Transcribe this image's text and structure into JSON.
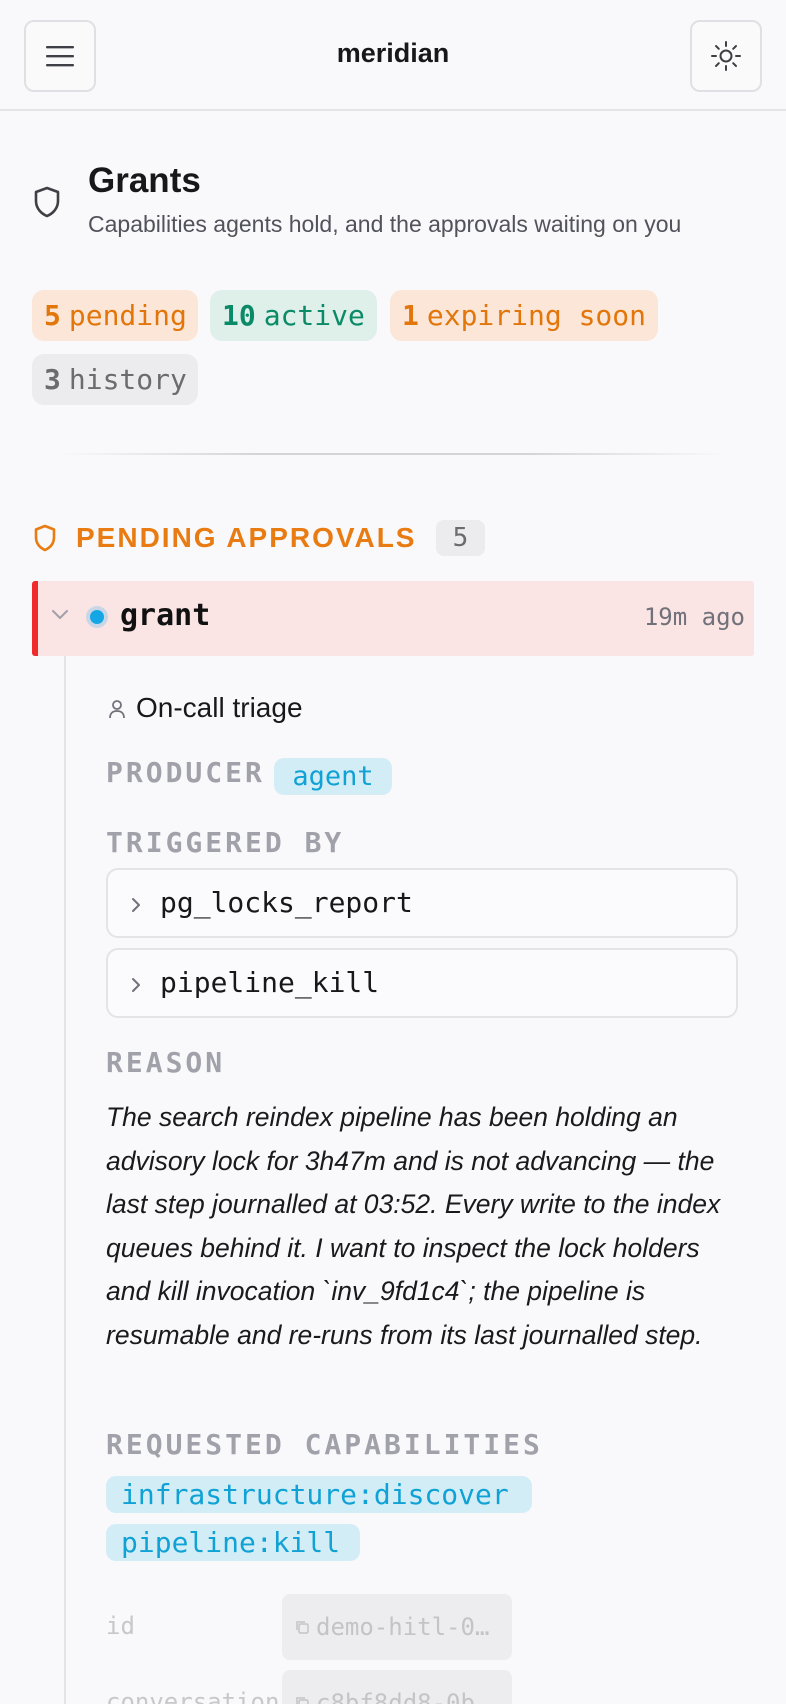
{
  "header": {
    "app_title": "meridian",
    "menu_icon": "menu-icon",
    "theme_icon": "sun-icon"
  },
  "page": {
    "icon": "shield-icon",
    "title": "Grants",
    "subtitle": "Capabilities agents hold, and the approvals waiting on you"
  },
  "summary": {
    "pending_count": "5",
    "pending_label": "pending",
    "active_count": "10",
    "active_label": "active",
    "expiring_count": "1",
    "expiring_label": "expiring soon",
    "history_count": "3",
    "history_label": "history"
  },
  "section": {
    "icon": "shield-icon",
    "title": "PENDING APPROVALS",
    "count": "5"
  },
  "request": {
    "kind": "grant",
    "time": "19m ago",
    "requester_icon": "user-icon",
    "requester": "On-call triage",
    "producer_label": "PRODUCER",
    "producer": "agent",
    "triggered_label": "TRIGGERED BY",
    "triggers": [
      "pg_locks_report",
      "pipeline_kill"
    ],
    "reason_label": "REASON",
    "reason": "The search reindex pipeline has been holding an advisory lock for 3h47m and is not advancing — the last step journalled at 03:52. Every write to the index queues behind it. I want to inspect the lock holders and kill invocation `inv_9fd1c4`; the pipeline is resumable and re-runs from its last journalled step.",
    "capabilities_label": "REQUESTED CAPABILITIES",
    "capabilities": [
      "infrastructure:discover",
      "pipeline:kill"
    ],
    "meta": [
      {
        "key": "id",
        "value": "demo-hitl-0…"
      },
      {
        "key": "conversation",
        "value": "c8bf8dd8-0b"
      }
    ]
  },
  "colors": {
    "accent_orange": "#e87c12",
    "active_green": "#0b8a68",
    "status_red": "#ef2b2b",
    "info_blue": "#10a2d4"
  }
}
